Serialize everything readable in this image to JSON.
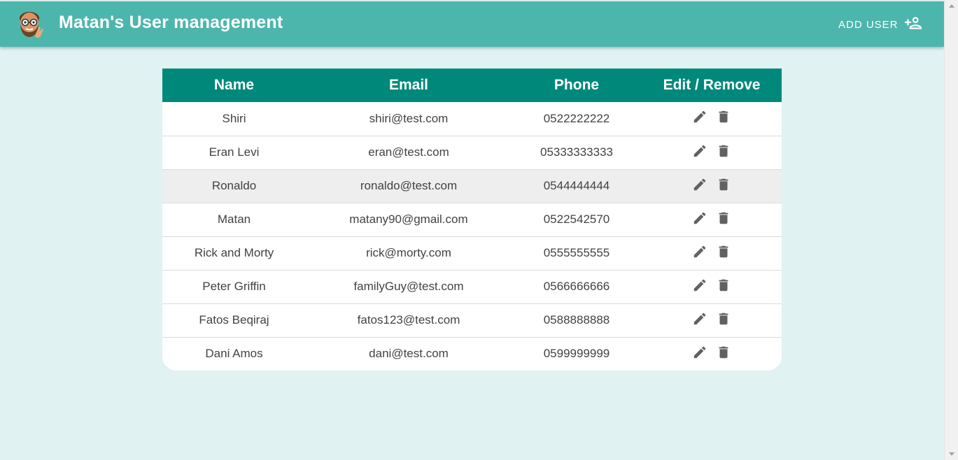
{
  "header": {
    "title": "Matan's User management",
    "add_user_label": "ADD USER",
    "brand_color": "#4db6ac"
  },
  "table": {
    "header_color": "#00897b",
    "columns": [
      "Name",
      "Email",
      "Phone",
      "Edit / Remove"
    ],
    "rows": [
      {
        "name": "Shiri",
        "email": "shiri@test.com",
        "phone": "0522222222"
      },
      {
        "name": "Eran Levi",
        "email": "eran@test.com",
        "phone": "05333333333"
      },
      {
        "name": "Ronaldo",
        "email": "ronaldo@test.com",
        "phone": "0544444444"
      },
      {
        "name": "Matan",
        "email": "matany90@gmail.com",
        "phone": "0522542570"
      },
      {
        "name": "Rick and Morty",
        "email": "rick@morty.com",
        "phone": "0555555555"
      },
      {
        "name": "Peter Griffin",
        "email": "familyGuy@test.com",
        "phone": "0566666666"
      },
      {
        "name": "Fatos Beqiraj",
        "email": "fatos123@test.com",
        "phone": "0588888888"
      },
      {
        "name": "Dani Amos",
        "email": "dani@test.com",
        "phone": "0599999999"
      }
    ],
    "row_icons": [
      "edit-icon",
      "delete-icon"
    ]
  }
}
